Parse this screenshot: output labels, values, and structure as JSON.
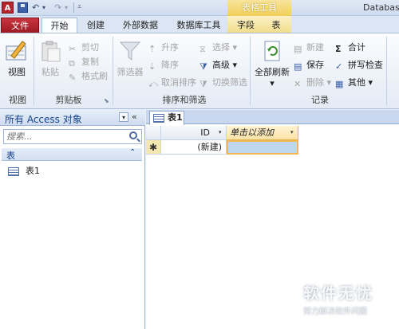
{
  "titlebar": {
    "app_icon_letter": "A",
    "context_tab_group": "表格工具",
    "window_title": "Databas"
  },
  "tabs": [
    "文件",
    "开始",
    "创建",
    "外部数据",
    "数据库工具",
    "字段",
    "表"
  ],
  "ribbon": {
    "view": {
      "label": "视图",
      "group": "视图"
    },
    "clipboard": {
      "paste": "粘贴",
      "cut": "剪切",
      "copy": "复制",
      "format_painter": "格式刷",
      "group": "剪贴板"
    },
    "sort_filter": {
      "filter": "筛选器",
      "ascending": "升序",
      "descending": "降序",
      "remove_sort": "取消排序",
      "selection": "选择",
      "advanced": "高级",
      "toggle_filter": "切换筛选",
      "group": "排序和筛选"
    },
    "records": {
      "refresh_all": "全部刷新",
      "new": "新建",
      "save": "保存",
      "delete": "删除",
      "totals": "合计",
      "spelling": "拼写检查",
      "more": "其他",
      "group": "记录"
    }
  },
  "navpane": {
    "title": "所有 Access 对象",
    "search_placeholder": "搜索...",
    "group_title": "表",
    "items": [
      {
        "label": "表1"
      }
    ]
  },
  "document": {
    "tab_label": "表1",
    "columns": [
      "ID",
      "单击以添加"
    ],
    "new_row_marker": "✱",
    "new_row_id_value": "(新建)"
  },
  "watermark": {
    "main": "软件无忧",
    "sub": "努力解决软件问题"
  },
  "colors": {
    "file_tab": "#b5262d",
    "contextual_tab": "#f1cf5b",
    "nav_title": "#15428b",
    "add_column": "#fbe3a6"
  }
}
